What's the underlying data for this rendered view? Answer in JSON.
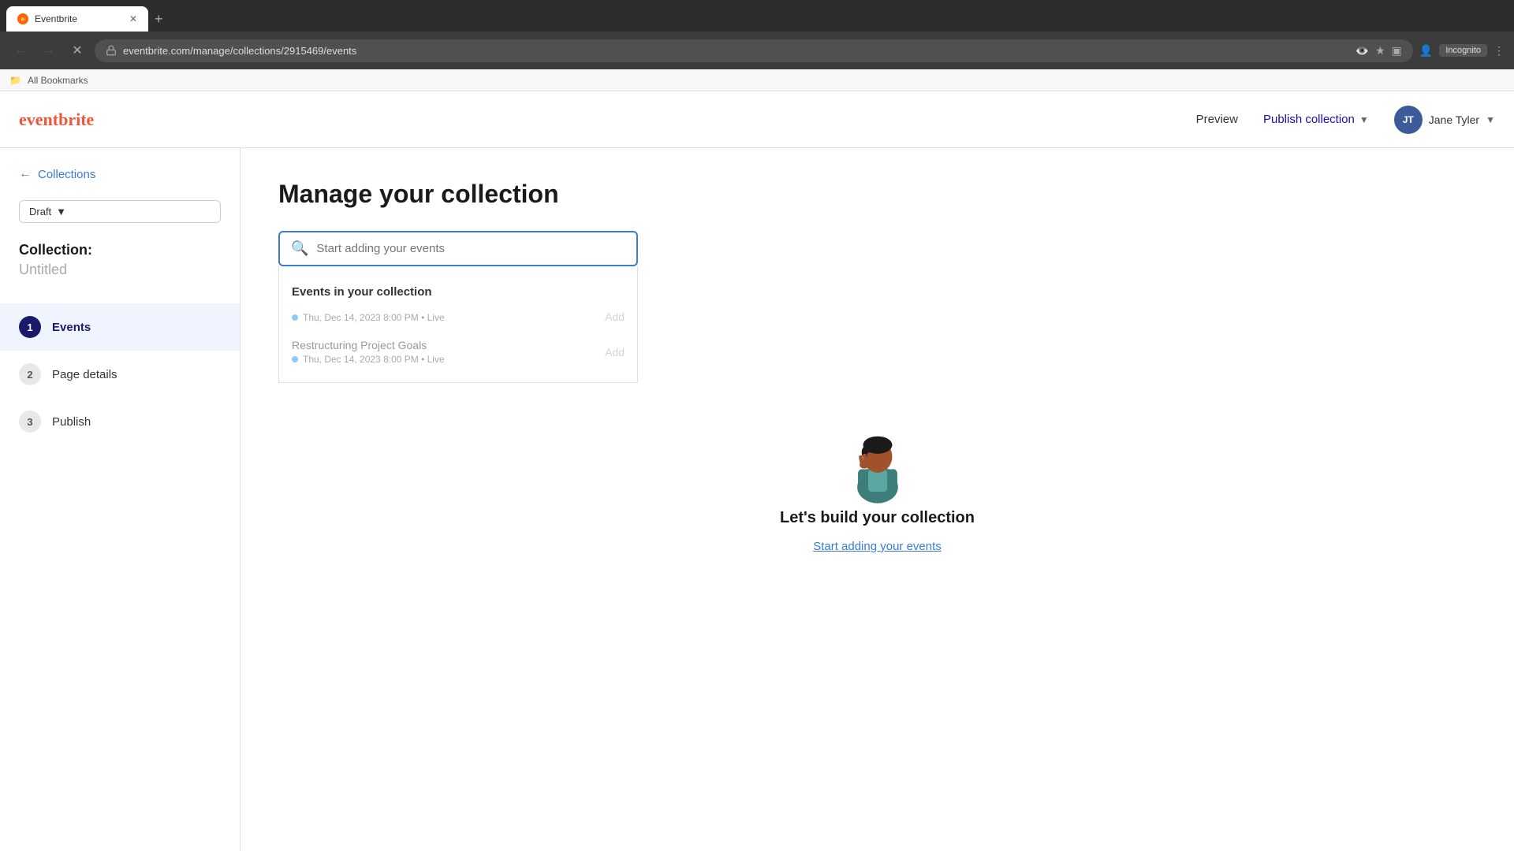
{
  "browser": {
    "tab_title": "Eventbrite",
    "url": "eventbrite.com/manage/collections/2915469/events",
    "nav_back": "←",
    "nav_forward": "→",
    "nav_refresh": "✕",
    "incognito_label": "Incognito",
    "bookmarks_label": "All Bookmarks"
  },
  "top_nav": {
    "logo": "eventbrite",
    "preview_label": "Preview",
    "publish_collection_label": "Publish collection",
    "user_initials": "JT",
    "user_name": "Jane Tyler"
  },
  "sidebar": {
    "back_label": "Collections",
    "draft_label": "Draft",
    "collection_label": "Collection:",
    "collection_name": "Untitled",
    "steps": [
      {
        "number": "1",
        "label": "Events",
        "active": true
      },
      {
        "number": "2",
        "label": "Page details",
        "active": false
      },
      {
        "number": "3",
        "label": "Publish",
        "active": false
      }
    ]
  },
  "main": {
    "page_title": "Manage your collection",
    "search_placeholder": "Start adding your events",
    "events_section_title": "Events in your collection",
    "events": [
      {
        "name": "",
        "date": "Thu, Dec 14, 2023 8:00 PM • Live",
        "add_label": "Add"
      },
      {
        "name": "Restructuring Project Goals",
        "date": "Thu, Dec 14, 2023 8:00 PM • Live",
        "add_label": "Add"
      }
    ],
    "empty_title": "Let's build your collection",
    "empty_link": "Start adding your events"
  }
}
